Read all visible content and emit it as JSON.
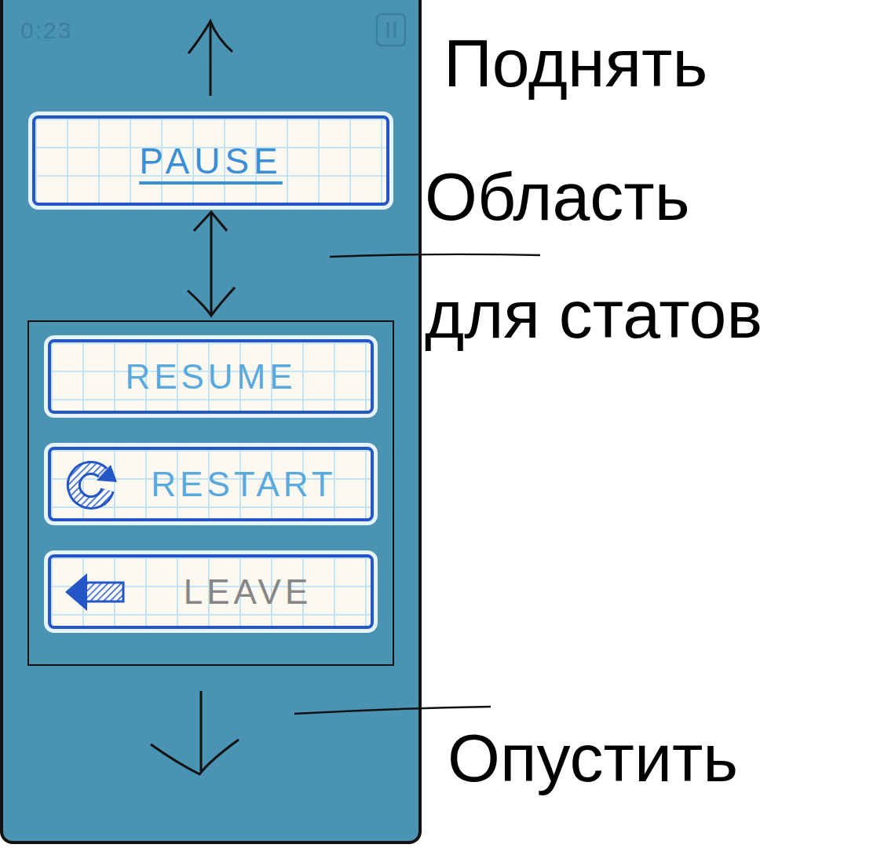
{
  "hud": {
    "timer": "0:23"
  },
  "menu": {
    "title": "PAUSE",
    "buttons": [
      {
        "label": "RESUME",
        "kind": "plain",
        "disabled": false
      },
      {
        "label": "RESTART",
        "kind": "restart",
        "disabled": false
      },
      {
        "label": "LEAVE",
        "kind": "leave",
        "disabled": true
      }
    ]
  },
  "annotations": [
    {
      "lines": [
        "Поднять"
      ]
    },
    {
      "lines": [
        "Область",
        "для статов"
      ]
    },
    {
      "lines": [
        "Опустить"
      ]
    }
  ]
}
